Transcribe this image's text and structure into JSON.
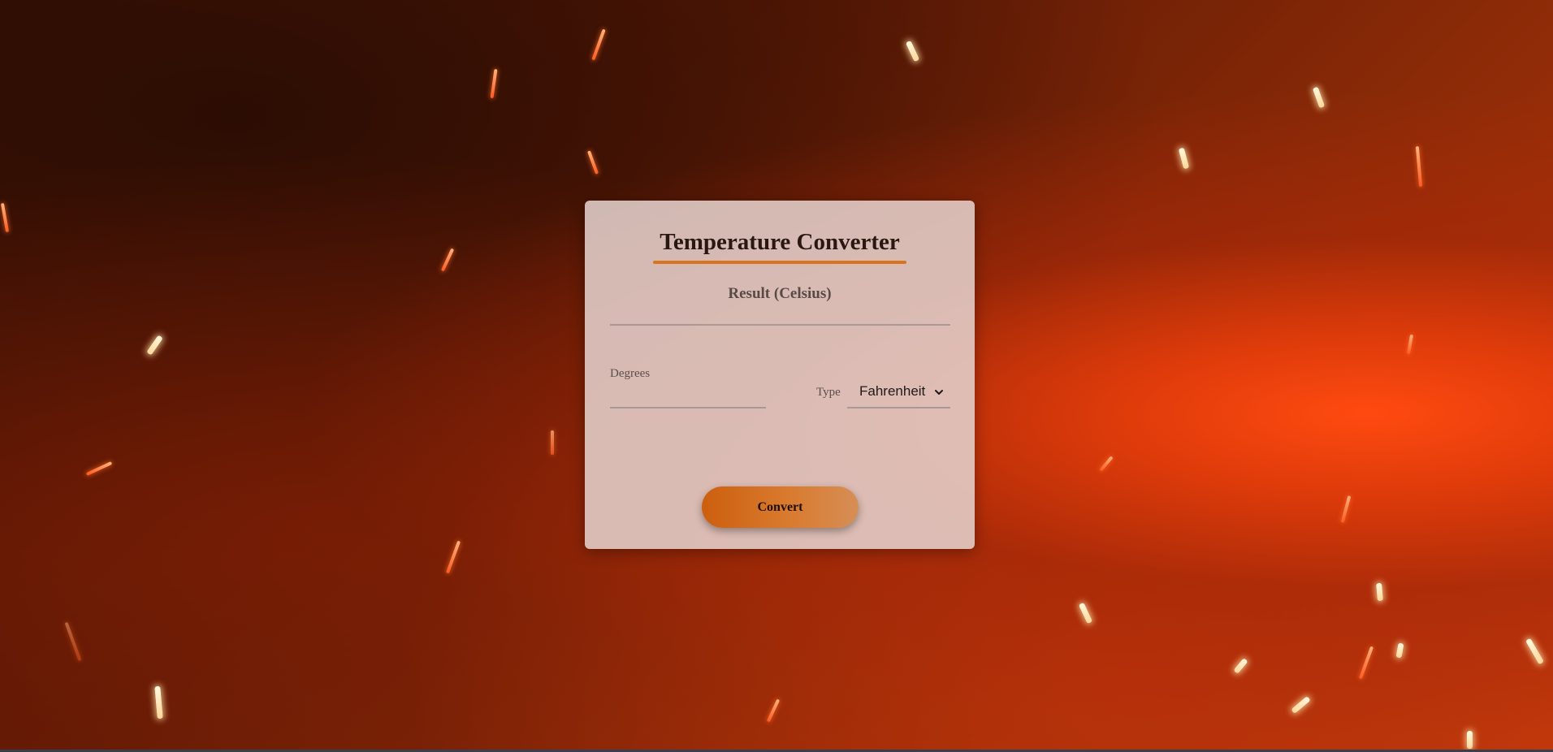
{
  "converter": {
    "title": "Temperature Converter",
    "result_label": "Result (Celsius)",
    "result_value": "",
    "degrees_label": "Degrees",
    "degrees_value": "",
    "type_label": "Type",
    "type_selected": "Fahrenheit",
    "convert_label": "Convert"
  },
  "colors": {
    "accent": "#d8741e",
    "card_bg": "#e4d0cc",
    "button_start": "#cc5f0e",
    "button_end": "#d68e56"
  },
  "icons": {
    "select_arrow": "chevron-down-icon"
  }
}
